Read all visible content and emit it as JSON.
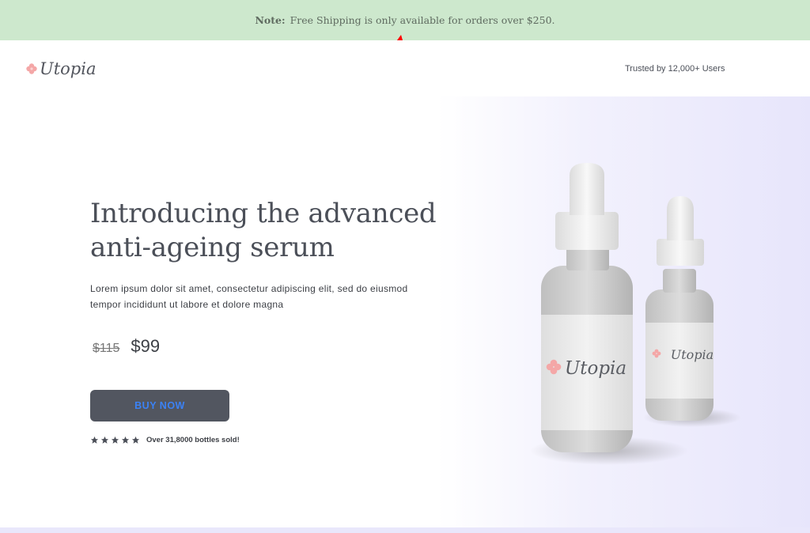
{
  "notice": {
    "label": "Note:",
    "text": "Free Shipping is only available for orders over $250."
  },
  "header": {
    "logo_text": "Utopia",
    "logo_icon": "flower-icon",
    "trusted": "Trusted by 12,000+ Users"
  },
  "hero": {
    "title": "Introducing the advanced anti-ageing serum",
    "description": "Lorem ipsum dolor sit amet, consectetur adipiscing elit, sed do eiusmod tempor incididunt ut labore et dolore magna",
    "old_price": "$115",
    "new_price": "$99",
    "buy_label": "BUY NOW",
    "rating": 5,
    "sold_text": "Over 31,8000 bottles sold!"
  },
  "product": {
    "bottle_large_label": "Utopia",
    "bottle_small_label": "Utopia"
  },
  "colors": {
    "notice_bg": "#cde8cd",
    "button_bg": "#525660",
    "button_text": "#3b82f6",
    "accent_pink": "#f4a7a7",
    "annotation_arrow": "#ff0000"
  }
}
